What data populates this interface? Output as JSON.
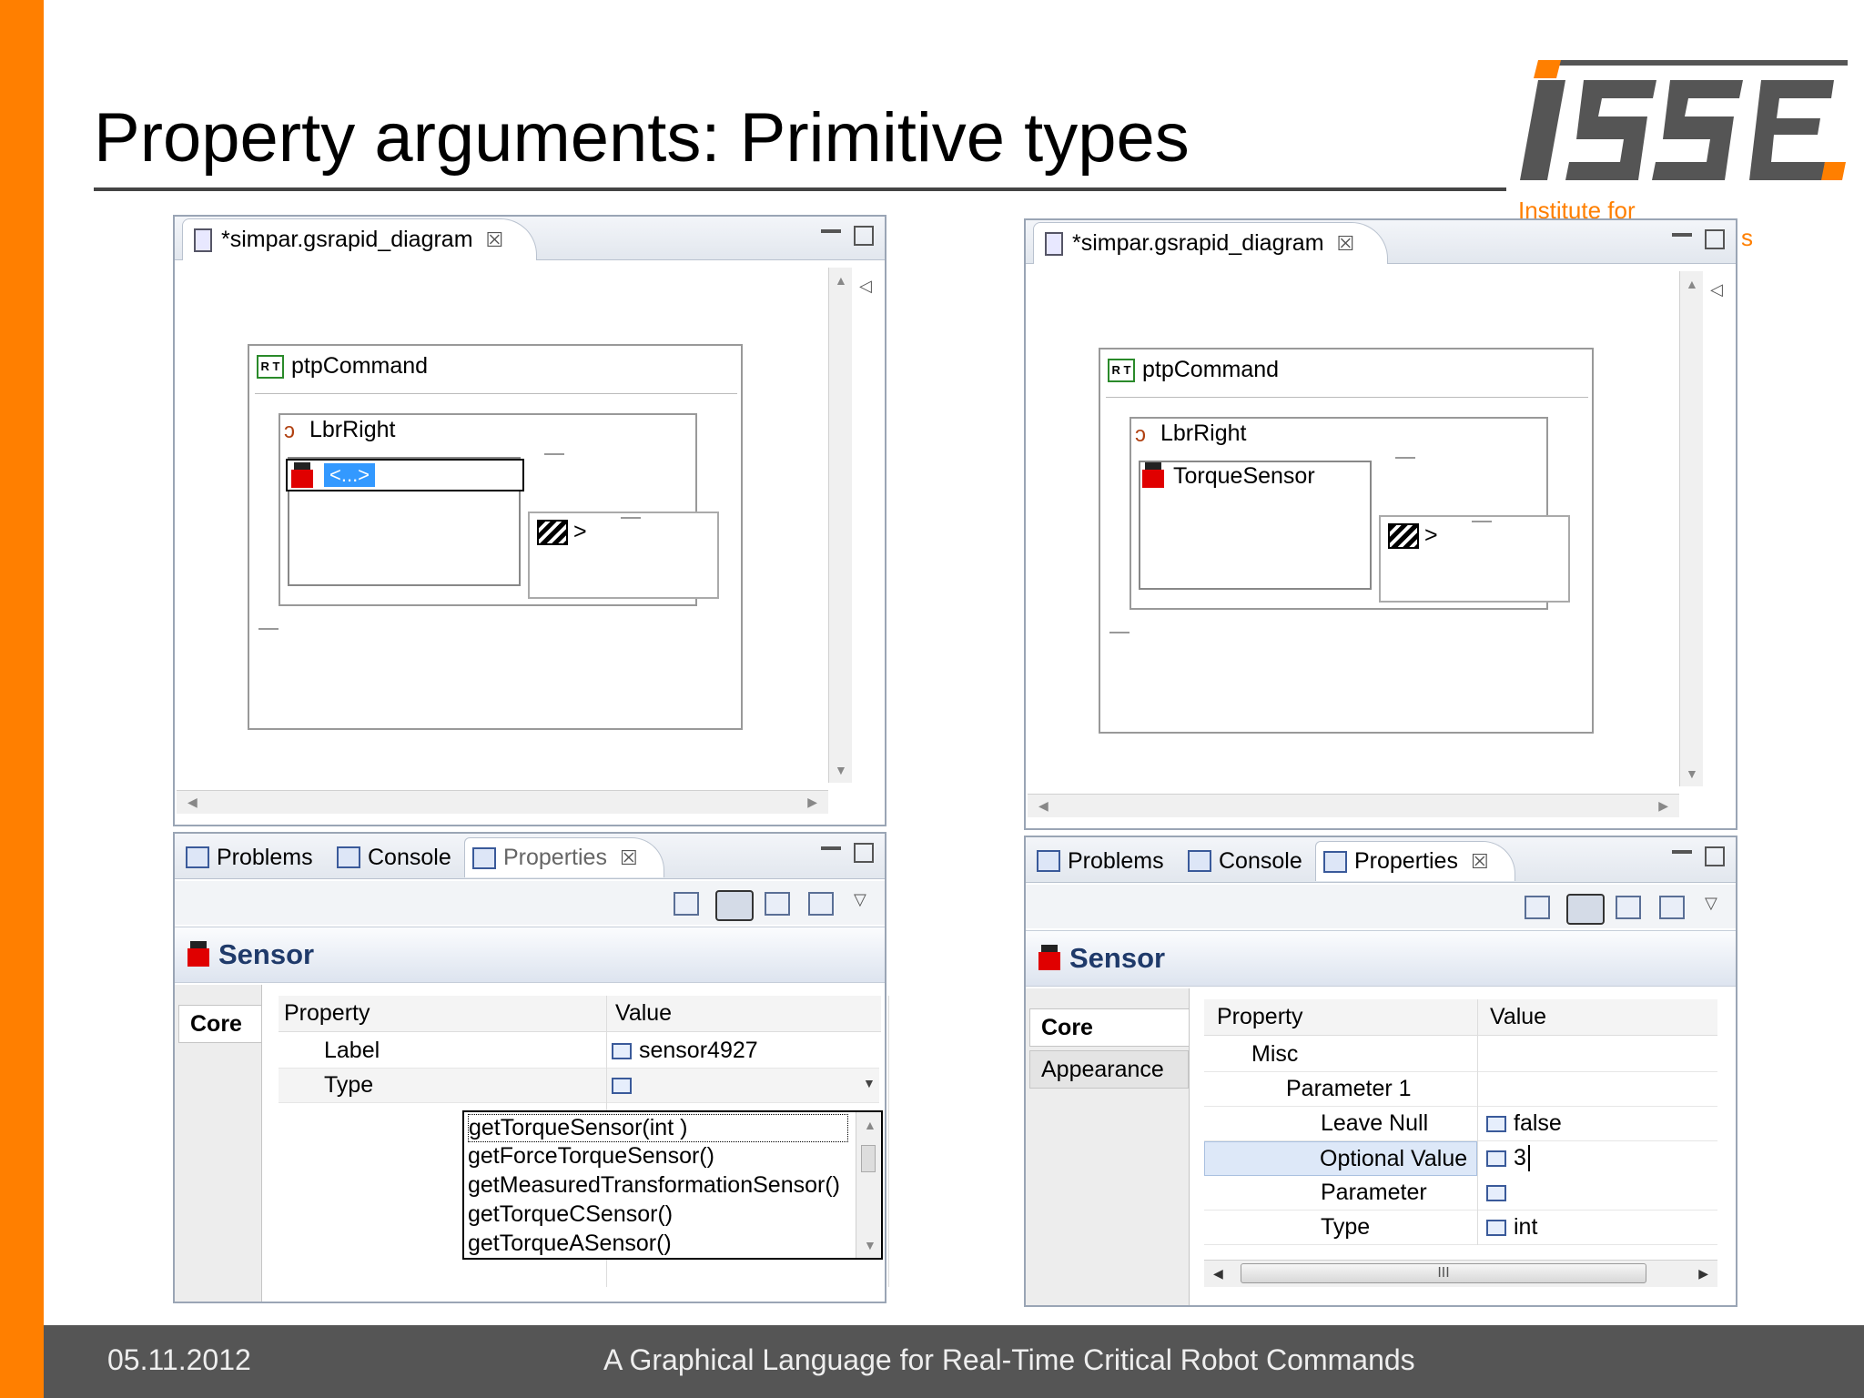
{
  "slide": {
    "title": "Property arguments: Primitive types",
    "footer_date": "05.11.2012",
    "footer_text": "A Graphical Language for Real-Time Critical Robot Commands",
    "logo_text": "ISSE",
    "logo_subtext": "Institute for",
    "logo_cut": "s"
  },
  "left": {
    "editor_tab": "*simpar.gsrapid_diagram",
    "command_label": "ptpCommand",
    "robot_label": "LbrRight",
    "sensor_edit_text": "<...>",
    "clap_label": ">",
    "tabs": [
      "Problems",
      "Console",
      "Properties"
    ],
    "header": "Sensor",
    "side_tabs": [
      "Core"
    ],
    "col_property": "Property",
    "col_value": "Value",
    "rows": [
      {
        "property": "Label",
        "value": "sensor4927"
      },
      {
        "property": "Type",
        "value": ""
      }
    ],
    "dropdown_items": [
      "getTorqueSensor(int )",
      "getForceTorqueSensor()",
      "getMeasuredTransformationSensor()",
      "getTorqueCSensor()",
      "getTorqueASensor()"
    ]
  },
  "right": {
    "editor_tab": "*simpar.gsrapid_diagram",
    "command_label": "ptpCommand",
    "robot_label": "LbrRight",
    "sensor_label": "TorqueSensor",
    "clap_label": ">",
    "tabs": [
      "Problems",
      "Console",
      "Properties"
    ],
    "header": "Sensor",
    "side_tabs": [
      "Core",
      "Appearance"
    ],
    "col_property": "Property",
    "col_value": "Value",
    "rows": [
      {
        "property": "Misc",
        "value": ""
      },
      {
        "property": "Parameter 1",
        "value": ""
      },
      {
        "property": "Leave Null",
        "value": "false"
      },
      {
        "property": "Optional Value",
        "value": "3"
      },
      {
        "property": "Parameter",
        "value": ""
      },
      {
        "property": "Type",
        "value": "int"
      }
    ],
    "hscroll_grip": "III"
  },
  "colors": {
    "accent": "#ff7f00",
    "footer": "#555555",
    "header_text": "#1f3a6a"
  }
}
